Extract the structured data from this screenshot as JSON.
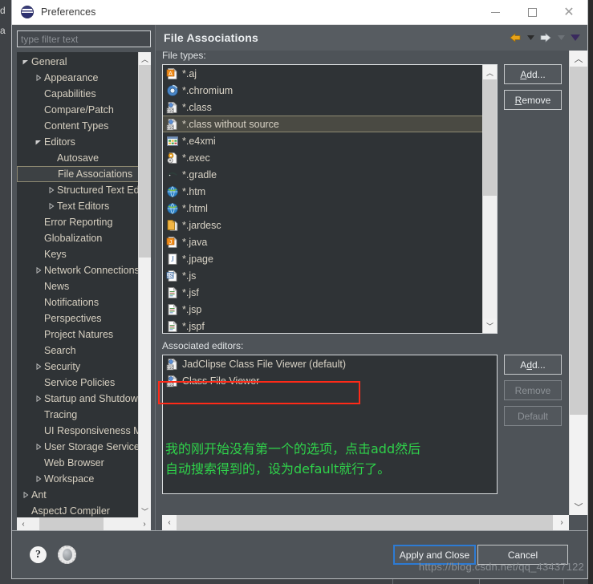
{
  "window": {
    "title": "Preferences",
    "app_icon": "eclipse-icon",
    "minimize_label": "Minimize",
    "maximize_label": "Maximize",
    "close_label": "Close"
  },
  "sidebar": {
    "filter": {
      "placeholder": "type filter text",
      "value": ""
    },
    "items": [
      {
        "label": "General",
        "indent": 0,
        "twisty": "down",
        "selected": false
      },
      {
        "label": "Appearance",
        "indent": 1,
        "twisty": "right",
        "selected": false
      },
      {
        "label": "Capabilities",
        "indent": 1,
        "twisty": "none",
        "selected": false
      },
      {
        "label": "Compare/Patch",
        "indent": 1,
        "twisty": "none",
        "selected": false
      },
      {
        "label": "Content Types",
        "indent": 1,
        "twisty": "none",
        "selected": false
      },
      {
        "label": "Editors",
        "indent": 1,
        "twisty": "down",
        "selected": false
      },
      {
        "label": "Autosave",
        "indent": 2,
        "twisty": "none",
        "selected": false
      },
      {
        "label": "File Associations",
        "indent": 2,
        "twisty": "none",
        "selected": true
      },
      {
        "label": "Structured Text Editors",
        "indent": 2,
        "twisty": "right",
        "selected": false
      },
      {
        "label": "Text Editors",
        "indent": 2,
        "twisty": "right",
        "selected": false
      },
      {
        "label": "Error Reporting",
        "indent": 1,
        "twisty": "none",
        "selected": false
      },
      {
        "label": "Globalization",
        "indent": 1,
        "twisty": "none",
        "selected": false
      },
      {
        "label": "Keys",
        "indent": 1,
        "twisty": "none",
        "selected": false
      },
      {
        "label": "Network Connections",
        "indent": 1,
        "twisty": "right",
        "selected": false
      },
      {
        "label": "News",
        "indent": 1,
        "twisty": "none",
        "selected": false
      },
      {
        "label": "Notifications",
        "indent": 1,
        "twisty": "none",
        "selected": false
      },
      {
        "label": "Perspectives",
        "indent": 1,
        "twisty": "none",
        "selected": false
      },
      {
        "label": "Project Natures",
        "indent": 1,
        "twisty": "none",
        "selected": false
      },
      {
        "label": "Search",
        "indent": 1,
        "twisty": "none",
        "selected": false
      },
      {
        "label": "Security",
        "indent": 1,
        "twisty": "right",
        "selected": false
      },
      {
        "label": "Service Policies",
        "indent": 1,
        "twisty": "none",
        "selected": false
      },
      {
        "label": "Startup and Shutdown",
        "indent": 1,
        "twisty": "right",
        "selected": false
      },
      {
        "label": "Tracing",
        "indent": 1,
        "twisty": "none",
        "selected": false
      },
      {
        "label": "UI Responsiveness Monitoring",
        "indent": 1,
        "twisty": "none",
        "selected": false
      },
      {
        "label": "User Storage Service",
        "indent": 1,
        "twisty": "right",
        "selected": false
      },
      {
        "label": "Web Browser",
        "indent": 1,
        "twisty": "none",
        "selected": false
      },
      {
        "label": "Workspace",
        "indent": 1,
        "twisty": "right",
        "selected": false
      },
      {
        "label": "Ant",
        "indent": 0,
        "twisty": "right",
        "selected": false
      },
      {
        "label": "AspectJ Compiler",
        "indent": 0,
        "twisty": "none",
        "selected": false
      }
    ]
  },
  "page": {
    "title": "File Associations",
    "nav": {
      "back_icon": "arrow-left-icon",
      "back_caret_icon": "caret-down-icon",
      "forward_icon": "arrow-right-icon",
      "forward_caret_icon": "caret-down-icon",
      "menu_caret_icon": "caret-down-icon"
    },
    "file_types": {
      "label": "File types:",
      "rows": [
        {
          "label": "*.aj",
          "icon": "aspectj-file-icon",
          "selected": false
        },
        {
          "label": "*.chromium",
          "icon": "chromium-icon",
          "selected": false
        },
        {
          "label": "*.class",
          "icon": "class-file-icon",
          "selected": false
        },
        {
          "label": "*.class without source",
          "icon": "class-file-icon",
          "selected": true
        },
        {
          "label": "*.e4xmi",
          "icon": "e4xmi-icon",
          "selected": false
        },
        {
          "label": "*.exec",
          "icon": "exec-icon",
          "selected": false
        },
        {
          "label": "*.gradle",
          "icon": "gradle-icon",
          "selected": false
        },
        {
          "label": "*.htm",
          "icon": "globe-icon",
          "selected": false
        },
        {
          "label": "*.html",
          "icon": "globe-icon",
          "selected": false
        },
        {
          "label": "*.jardesc",
          "icon": "jar-icon",
          "selected": false
        },
        {
          "label": "*.java",
          "icon": "java-file-icon",
          "selected": false
        },
        {
          "label": "*.jpage",
          "icon": "jpage-icon",
          "selected": false
        },
        {
          "label": "*.js",
          "icon": "javascript-icon",
          "selected": false
        },
        {
          "label": "*.jsf",
          "icon": "page-icon",
          "selected": false
        },
        {
          "label": "*.jsp",
          "icon": "page-icon",
          "selected": false
        },
        {
          "label": "*.jspf",
          "icon": "page-icon",
          "selected": false
        }
      ],
      "add_label": "Add...",
      "add_mnemonic": "A",
      "remove_label": "Remove",
      "remove_mnemonic": "R"
    },
    "associated_editors": {
      "label": "Associated editors:",
      "rows": [
        {
          "label": "JadClipse Class File Viewer (default)",
          "icon": "class-file-icon",
          "highlighted": true
        },
        {
          "label": "Class File Viewer",
          "icon": "class-file-icon",
          "highlighted": false
        }
      ],
      "add_label": "Add...",
      "add_mnemonic": "d",
      "remove_label": "Remove",
      "default_label": "Default"
    },
    "annotation": {
      "line1": "我的刚开始没有第一个的选项，点击add然后",
      "line2": "自动搜索得到的，设为default就行了。",
      "color": "#2fd24a",
      "box_color": "#ff2a18"
    }
  },
  "footer": {
    "help_icon": "question-mark-icon",
    "sphere_icon": "restore-defaults-icon",
    "apply_label": "Apply and Close",
    "cancel_label": "Cancel"
  },
  "watermark": "https://blog.csdn.net/qq_43437122",
  "behind_window": {
    "text1": "d",
    "text2": "a"
  }
}
